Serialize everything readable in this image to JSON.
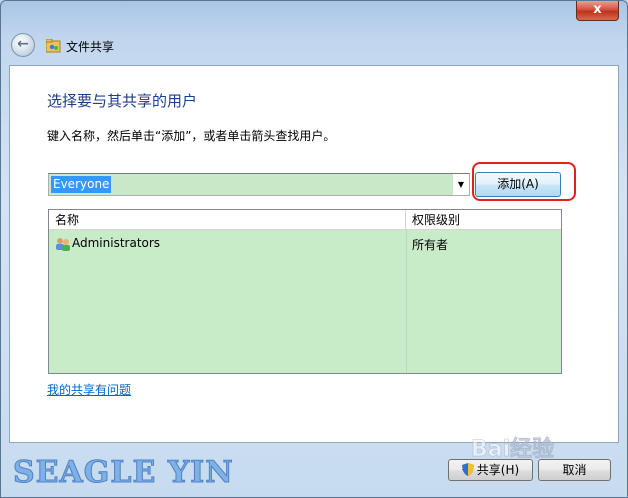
{
  "window": {
    "title": "文件共享",
    "close_label": "x"
  },
  "main": {
    "heading": "选择要与其共享的用户",
    "instruction": "键入名称，然后单击“添加”，或者单击箭头查找用户。",
    "combo_value": "Everyone",
    "add_button_label": "添加(A)"
  },
  "table": {
    "columns": [
      "名称",
      "权限级别"
    ],
    "rows": [
      {
        "name": "Administrators",
        "permission": "所有者"
      }
    ]
  },
  "help_link": "我的共享有问题",
  "footer": {
    "share_label": "共享(H)",
    "cancel_label": "取消"
  },
  "watermark": "SEAGLE YIN",
  "baidu_mark": "Bai经验",
  "colors": {
    "highlight_red": "#e0221c",
    "list_bg": "#c8ebc8",
    "heading_blue": "#1e3d8a",
    "link_blue": "#0066cc"
  }
}
